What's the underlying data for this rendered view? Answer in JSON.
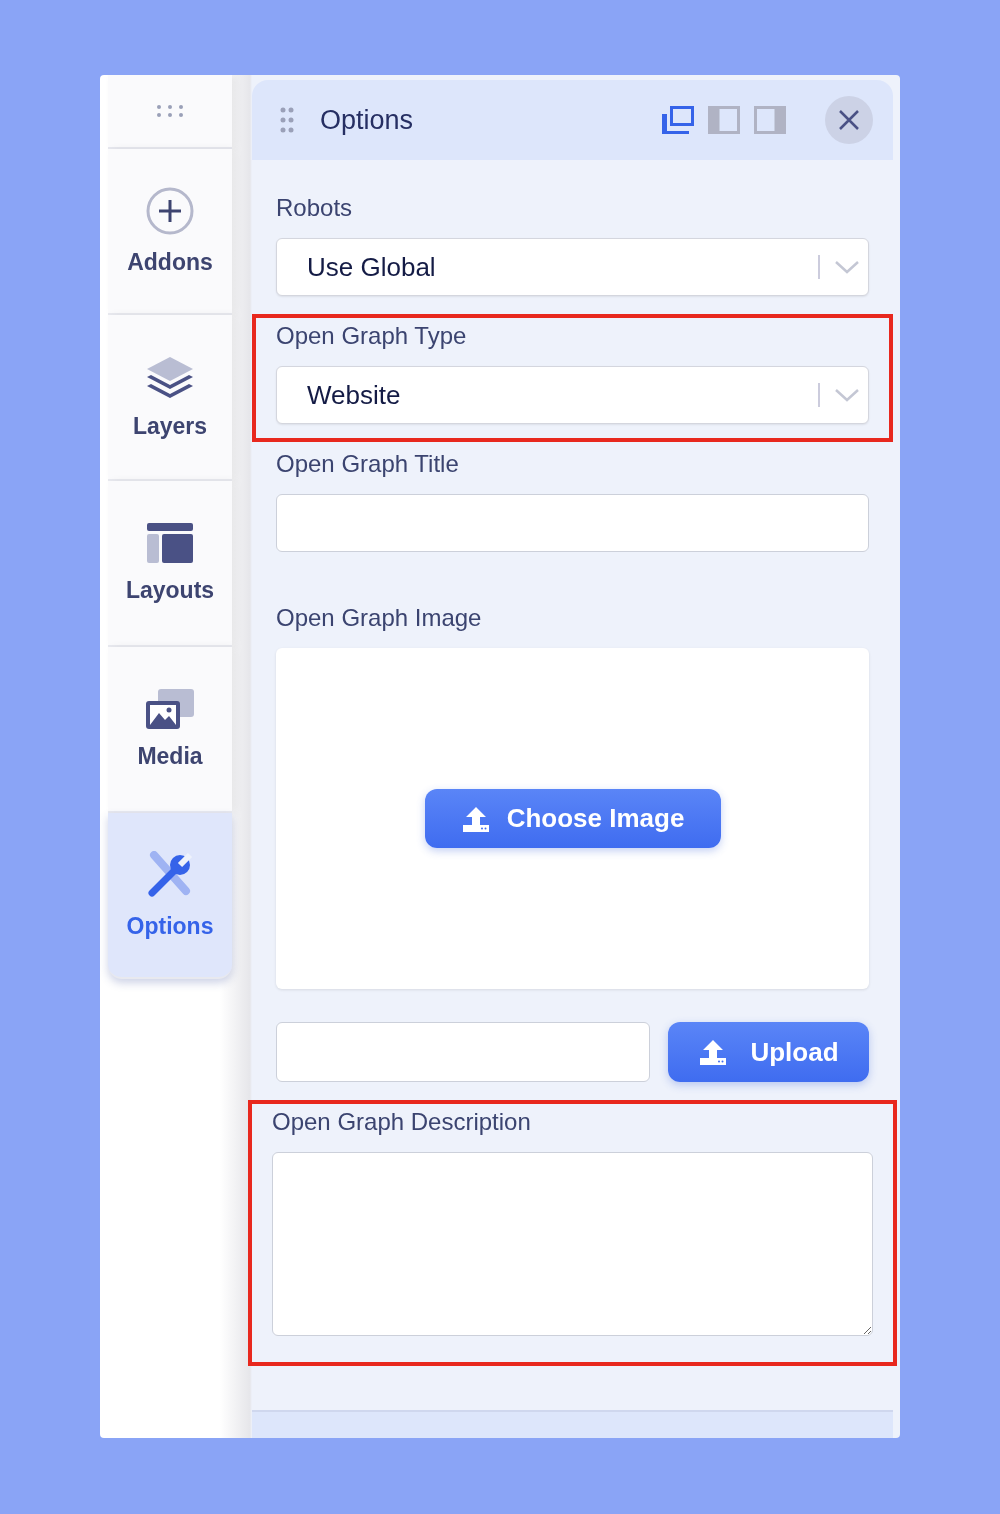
{
  "sidebar": {
    "items": [
      {
        "label": "Addons",
        "selected": false
      },
      {
        "label": "Layers",
        "selected": false
      },
      {
        "label": "Layouts",
        "selected": false
      },
      {
        "label": "Media",
        "selected": false
      },
      {
        "label": "Options",
        "selected": true
      }
    ]
  },
  "panel": {
    "title": "Options",
    "view_modes": [
      {
        "selected": true
      },
      {
        "selected": false
      },
      {
        "selected": false
      }
    ],
    "fields": [
      {
        "kind": "select",
        "label": "Robots",
        "value": "Use Global",
        "highlighted": false
      },
      {
        "kind": "select",
        "label": "Open Graph Type",
        "value": "Website",
        "highlighted": true
      },
      {
        "kind": "text",
        "label": "Open Graph Title",
        "highlighted": false
      },
      {
        "kind": "image",
        "label": "Open Graph Image",
        "button": "Choose Image",
        "upload": "Upload",
        "highlighted": false
      },
      {
        "kind": "textarea",
        "label": "Open Graph Description",
        "highlighted": true
      }
    ]
  }
}
